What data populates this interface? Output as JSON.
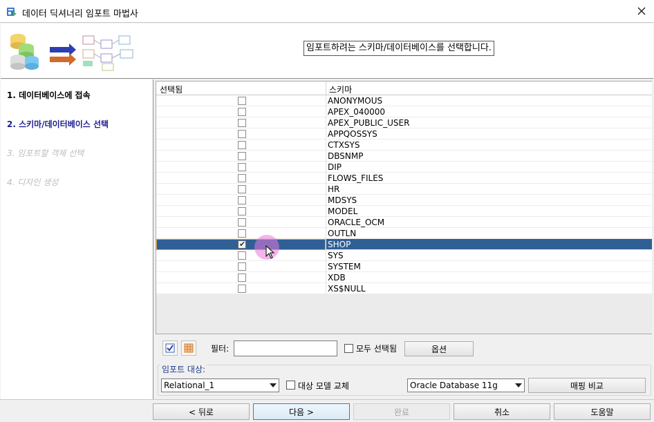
{
  "window": {
    "title": "데이터 딕셔너리 임포트 마법사"
  },
  "header": {
    "instruction": "임포트하려는 스키마/데이터베이스를 선택합니다."
  },
  "steps": [
    {
      "label": "1. 데이터베이스에 접속",
      "state": "done"
    },
    {
      "label": "2. 스키마/데이터베이스 선택",
      "state": "current"
    },
    {
      "label": "3. 임포트할 객체 선택",
      "state": "disabled"
    },
    {
      "label": "4. 디자인 생성",
      "state": "disabled"
    }
  ],
  "table": {
    "columns": [
      "선택됨",
      "스키마"
    ],
    "rows": [
      {
        "name": "ANONYMOUS",
        "checked": false,
        "selected": false
      },
      {
        "name": "APEX_040000",
        "checked": false,
        "selected": false
      },
      {
        "name": "APEX_PUBLIC_USER",
        "checked": false,
        "selected": false
      },
      {
        "name": "APPQOSSYS",
        "checked": false,
        "selected": false
      },
      {
        "name": "CTXSYS",
        "checked": false,
        "selected": false
      },
      {
        "name": "DBSNMP",
        "checked": false,
        "selected": false
      },
      {
        "name": "DIP",
        "checked": false,
        "selected": false
      },
      {
        "name": "FLOWS_FILES",
        "checked": false,
        "selected": false
      },
      {
        "name": "HR",
        "checked": false,
        "selected": false
      },
      {
        "name": "MDSYS",
        "checked": false,
        "selected": false
      },
      {
        "name": "MODEL",
        "checked": false,
        "selected": false
      },
      {
        "name": "ORACLE_OCM",
        "checked": false,
        "selected": false
      },
      {
        "name": "OUTLN",
        "checked": false,
        "selected": false
      },
      {
        "name": "SHOP",
        "checked": true,
        "selected": true
      },
      {
        "name": "SYS",
        "checked": false,
        "selected": false
      },
      {
        "name": "SYSTEM",
        "checked": false,
        "selected": false
      },
      {
        "name": "XDB",
        "checked": false,
        "selected": false
      },
      {
        "name": "XS$NULL",
        "checked": false,
        "selected": false
      }
    ]
  },
  "tools": {
    "filter_label": "필터:",
    "filter_value": "",
    "select_all_label": "모두 선택됨",
    "select_all_checked": false,
    "options_label": "옵션"
  },
  "target": {
    "label": "임포트 대상:",
    "model": "Relational_1",
    "replace_label": "대상 모델 교체",
    "replace_checked": false,
    "database": "Oracle Database 11g",
    "compare_label": "매핑 비교"
  },
  "footer": {
    "back": "< 뒤로",
    "next": "다음 >",
    "finish": "완료",
    "cancel": "취소",
    "help": "도움말"
  },
  "colors": {
    "selection": "#305f94",
    "current_step": "#1c1f8f",
    "disabled_text": "#bdbdbd"
  }
}
